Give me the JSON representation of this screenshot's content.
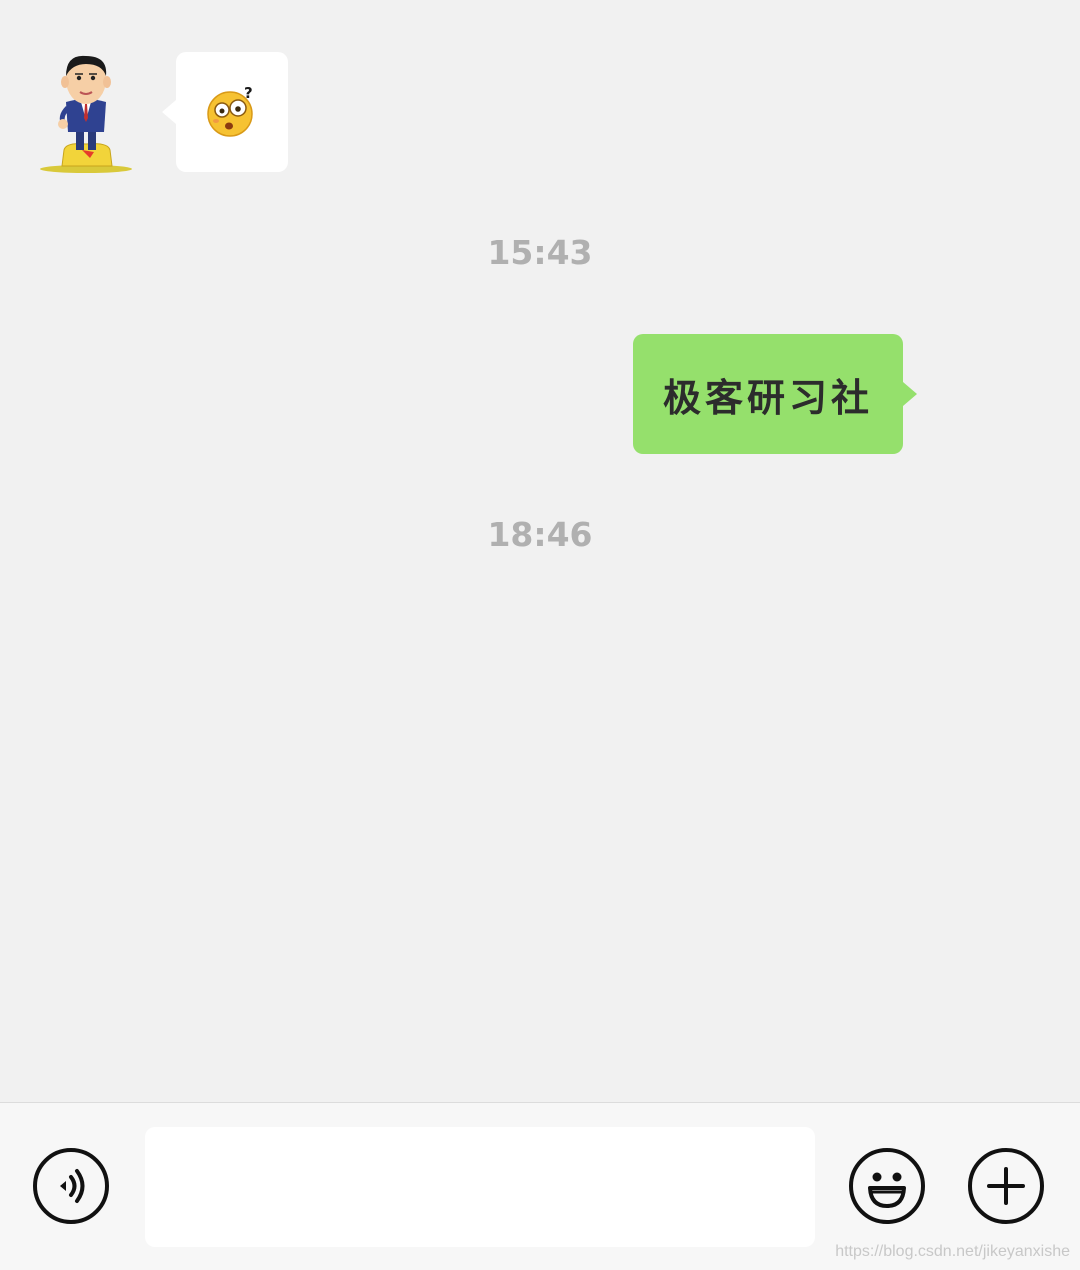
{
  "messages": {
    "incoming": {
      "avatar_icon": "cartoon-man-avatar-icon",
      "sticker_icon": "confused-face-emoji-icon"
    },
    "timestamp_1": "15:43",
    "outgoing": {
      "text": "极客研习社"
    },
    "timestamp_2": "18:46"
  },
  "input_bar": {
    "voice_icon": "voice-input-icon",
    "input_value": "",
    "emoji_icon": "emoji-icon",
    "plus_icon": "plus-icon"
  },
  "watermark": "https://blog.csdn.net/jikeyanxishe",
  "colors": {
    "background": "#f1f1f1",
    "outgoing_bubble": "#95e06c",
    "incoming_bubble": "#ffffff",
    "timestamp": "#b0b0b0"
  }
}
